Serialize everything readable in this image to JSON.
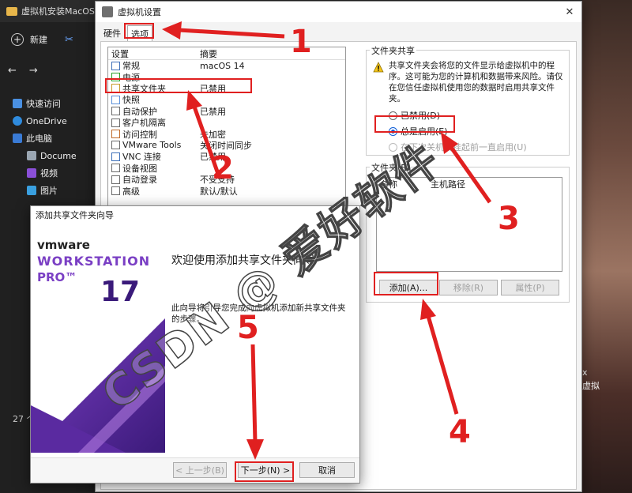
{
  "explorer": {
    "title": "虚拟机安装MacOS",
    "new_label": "新建",
    "nav_back": "←",
    "nav_forward": "→",
    "sidebar": [
      {
        "label": "快速访问",
        "icon": "star-icon"
      },
      {
        "label": "OneDrive",
        "icon": "cloud-icon"
      },
      {
        "label": "此电脑",
        "icon": "computer-icon"
      },
      {
        "label": "Docume",
        "icon": "document-icon"
      },
      {
        "label": "视频",
        "icon": "video-icon"
      },
      {
        "label": "图片",
        "icon": "picture-icon"
      }
    ],
    "status": "27 个"
  },
  "background_right": {
    "line1": "x",
    "line2": "虚拟"
  },
  "settings": {
    "title": "虚拟机设置",
    "tabs": [
      {
        "label": "硬件"
      },
      {
        "label": "选项"
      }
    ],
    "list_headers": {
      "setting": "设置",
      "summary": "摘要"
    },
    "rows": [
      {
        "name": "常规",
        "summary": "macOS 14",
        "icon": "monitor-icon"
      },
      {
        "name": "电源",
        "summary": "",
        "icon": "play-icon"
      },
      {
        "name": "共享文件夹",
        "summary": "已禁用",
        "icon": "folder-share-icon"
      },
      {
        "name": "快照",
        "summary": "",
        "icon": "snapshot-icon"
      },
      {
        "name": "自动保护",
        "summary": "已禁用",
        "icon": "clock-icon"
      },
      {
        "name": "客户机隔离",
        "summary": "",
        "icon": "lock-icon"
      },
      {
        "name": "访问控制",
        "summary": "未加密",
        "icon": "access-icon"
      },
      {
        "name": "VMware Tools",
        "summary": "关闭时间同步",
        "icon": "vmtools-icon"
      },
      {
        "name": "VNC 连接",
        "summary": "已禁用",
        "icon": "vnc-icon"
      },
      {
        "name": "设备视图",
        "summary": "",
        "icon": "device-icon"
      },
      {
        "name": "自动登录",
        "summary": "不受支持",
        "icon": "login-icon"
      },
      {
        "name": "高级",
        "summary": "默认/默认",
        "icon": "advanced-icon"
      }
    ],
    "share_group": {
      "title": "文件夹共享",
      "description": "共享文件夹会将您的文件显示给虚拟机中的程序。这可能为您的计算机和数据带来风险。请仅在您信任虚拟机使用您的数据时启用共享文件夹。",
      "options": [
        {
          "label": "已禁用(D)",
          "state": "off"
        },
        {
          "label": "总是启用(E)",
          "state": "on"
        },
        {
          "label": "在下次关机或挂起前一直启用(U)",
          "state": "disabled"
        }
      ]
    },
    "folders_group": {
      "title": "文件夹(F)",
      "columns": [
        "名称",
        "主机路径"
      ],
      "add_label": "添加(A)...",
      "remove_label": "移除(R)",
      "properties_label": "属性(P)"
    }
  },
  "wizard": {
    "title": "添加共享文件夹向导",
    "brand_vmware": "vmware",
    "brand_workstation": "WORKSTATION",
    "brand_pro": "PRO™",
    "brand_version": "17",
    "heading": "欢迎使用添加共享文件夹向导",
    "description": "此向导将引导您完成向虚拟机添加新共享文件夹的步骤。",
    "back_label": "< 上一步(B)",
    "next_label": "下一步(N) >",
    "cancel_label": "取消"
  },
  "annotations": [
    "1",
    "2",
    "3",
    "4",
    "5"
  ],
  "watermark": "CSDN @ 爱好软件",
  "colors": {
    "annotation": "#e02020",
    "accent": "#0b5cd7",
    "brand_purple": "#6a2fb0"
  }
}
